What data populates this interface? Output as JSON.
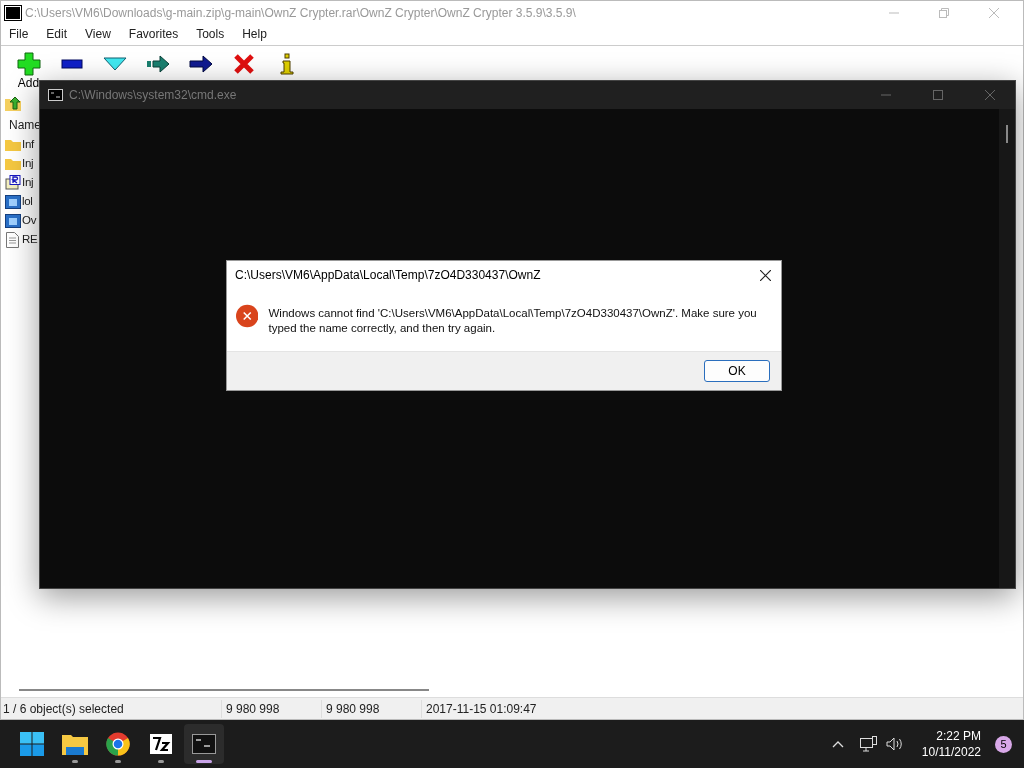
{
  "archive_window": {
    "title": "C:\\Users\\VM6\\Downloads\\g-main.zip\\g-main\\OwnZ Crypter.rar\\OwnZ Crypter\\OwnZ Crypter 3.5.9\\3.5.9\\",
    "menu": [
      "File",
      "Edit",
      "View",
      "Favorites",
      "Tools",
      "Help"
    ],
    "toolbar": [
      {
        "kind": "add",
        "label": "Add"
      },
      {
        "kind": "extract"
      },
      {
        "kind": "test"
      },
      {
        "kind": "copy"
      },
      {
        "kind": "move"
      },
      {
        "kind": "delete"
      },
      {
        "kind": "info"
      }
    ],
    "column_1": "Name",
    "files": [
      {
        "kind": "folder",
        "name": "Inf"
      },
      {
        "kind": "folder",
        "name": "Inj"
      },
      {
        "kind": "registry",
        "name": "Inj"
      },
      {
        "kind": "program",
        "name": "lol"
      },
      {
        "kind": "program",
        "name": "Ov"
      },
      {
        "kind": "text",
        "name": "RE"
      }
    ],
    "status_bar": [
      "1 / 6 object(s) selected",
      "9 980 998",
      "9 980 998",
      "2017-11-15 01:09:47"
    ]
  },
  "console_window": {
    "title": "C:\\Windows\\system32\\cmd.exe"
  },
  "dialog": {
    "title": "C:\\Users\\VM6\\AppData\\Local\\Temp\\7zO4D330437\\OwnZ",
    "message": "Windows cannot find 'C:\\Users\\VM6\\AppData\\Local\\Temp\\7zO4D330437\\OwnZ'. Make sure you typed the name correctly, and then try again.",
    "button": "OK"
  },
  "taskbar": {
    "apps": [
      {
        "kind": "start",
        "running": false,
        "selected": false
      },
      {
        "kind": "explorer",
        "running": true,
        "selected": false
      },
      {
        "kind": "chrome",
        "running": true,
        "selected": false
      },
      {
        "kind": "sevenzip",
        "running": true,
        "selected": false
      },
      {
        "kind": "terminal",
        "running": true,
        "selected": true
      }
    ],
    "time": "2:22 PM",
    "date": "10/11/2022",
    "notifications": "5"
  }
}
